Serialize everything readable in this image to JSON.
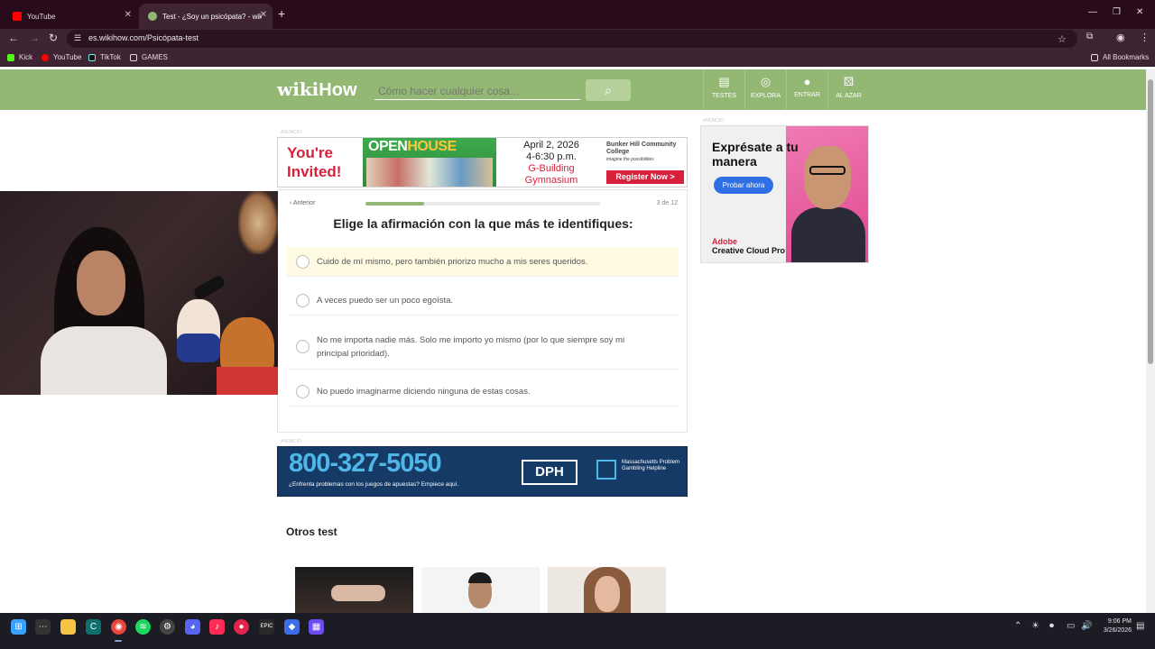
{
  "browser": {
    "tabs": [
      {
        "title": "YouTube",
        "active": false
      },
      {
        "title": "Test - ¿Soy un psicópata? - wiki",
        "active": true
      }
    ],
    "url": "es.wikihow.com/Psicópata-test",
    "bookmarks": [
      "Kick",
      "YouTube",
      "TikTok",
      "GAMES"
    ],
    "all_bookmarks": "All Bookmarks"
  },
  "header": {
    "logo_wiki": "wiki",
    "logo_how": "How",
    "search_placeholder": "Cómo hacer cualquier cosa...",
    "nav": [
      {
        "label": "TESTES",
        "icon": "clipboard-icon"
      },
      {
        "label": "EXPLORA",
        "icon": "compass-icon"
      },
      {
        "label": "ENTRAR",
        "icon": "user-icon"
      },
      {
        "label": "AL AZAR",
        "icon": "dice-icon"
      }
    ]
  },
  "ads": {
    "label": "ANUNCIO",
    "top": {
      "headline": "You're Invited!",
      "open": "OPEN",
      "house": "HOUSE",
      "date": "April 2, 2026",
      "time": "4-6:30 p.m.",
      "place1": "G-Building",
      "place2": "Gymnasium",
      "college": "Bunker Hill Community College",
      "college_tag": "imagine the possibilities",
      "cta": "Register Now >"
    },
    "bottom": {
      "phone": "800-327-5050",
      "subtitle": "¿Enfrenta problemas con los juegos de apuestas? Empiece aquí.",
      "dph": "DPH",
      "helpline": "Massachusetts Problem Gambling Helpline"
    },
    "side": {
      "title": "Exprésate a tu manera",
      "button": "Probar ahora",
      "brand1": "Adobe",
      "brand2": "Creative Cloud Pro"
    }
  },
  "quiz": {
    "prev": "Anterior",
    "progress": 0.25,
    "counter": "3 de 12",
    "question": "Elige la afirmación con la que más te identifiques:",
    "options": [
      "Cuido de mí mismo, pero también priorizo mucho a mis seres queridos.",
      "A veces puedo ser un poco egoísta.",
      "No me importa nadie más. Solo me importo yo mismo (por lo que siempre soy mi principal prioridad).",
      "No puedo imaginarme diciendo ninguna de estas cosas."
    ]
  },
  "others_title": "Otros test",
  "taskbar": {
    "time": "9:06 PM",
    "date": "3/26/2026"
  }
}
